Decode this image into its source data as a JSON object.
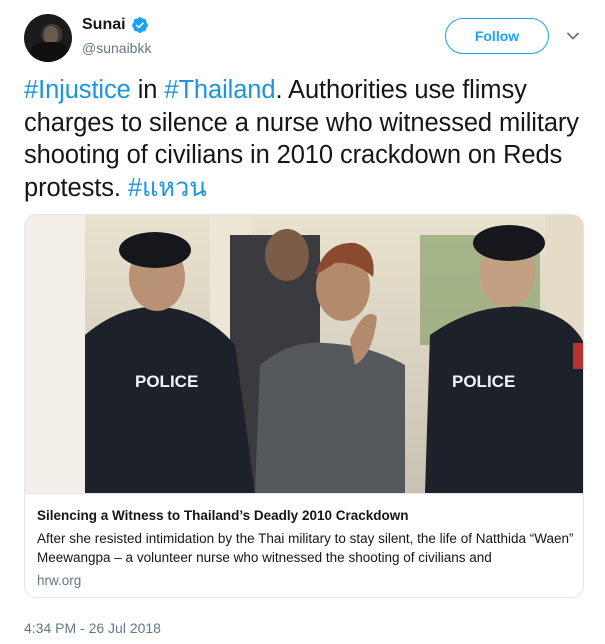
{
  "author": {
    "display_name": "Sunai",
    "handle": "@sunaibkk",
    "verified": true,
    "avatar_icon": "profile-photo"
  },
  "actions": {
    "follow_label": "Follow",
    "more_icon": "chevron-down-icon"
  },
  "tweet": {
    "segments": [
      {
        "text": "#Injustice",
        "type": "hashtag"
      },
      {
        "text": " in ",
        "type": "text"
      },
      {
        "text": "#Thailand",
        "type": "hashtag"
      },
      {
        "text": ". Authorities use flimsy charges to silence a nurse who witnessed military shooting of civilians in 2010 crackdown on Reds protests. ",
        "type": "text"
      },
      {
        "text": "#แหวน",
        "type": "hashtag"
      }
    ]
  },
  "card": {
    "image_desc": "",
    "badge_left": "POLICE",
    "badge_right": "POLICE",
    "title": "Silencing a Witness to Thailand’s Deadly 2010 Crackdown",
    "description": "After she resisted intimidation by the Thai military to stay silent, the life of Natthida “Waen” Meewangpa – a volunteer nurse who witnessed the shooting of civilians and",
    "domain": "hrw.org"
  },
  "timestamp": "4:34 PM - 26 Jul 2018",
  "colors": {
    "link": "#1b95e0",
    "follow": "#1da1f2",
    "muted": "#657786",
    "border": "#e1e8ed"
  }
}
